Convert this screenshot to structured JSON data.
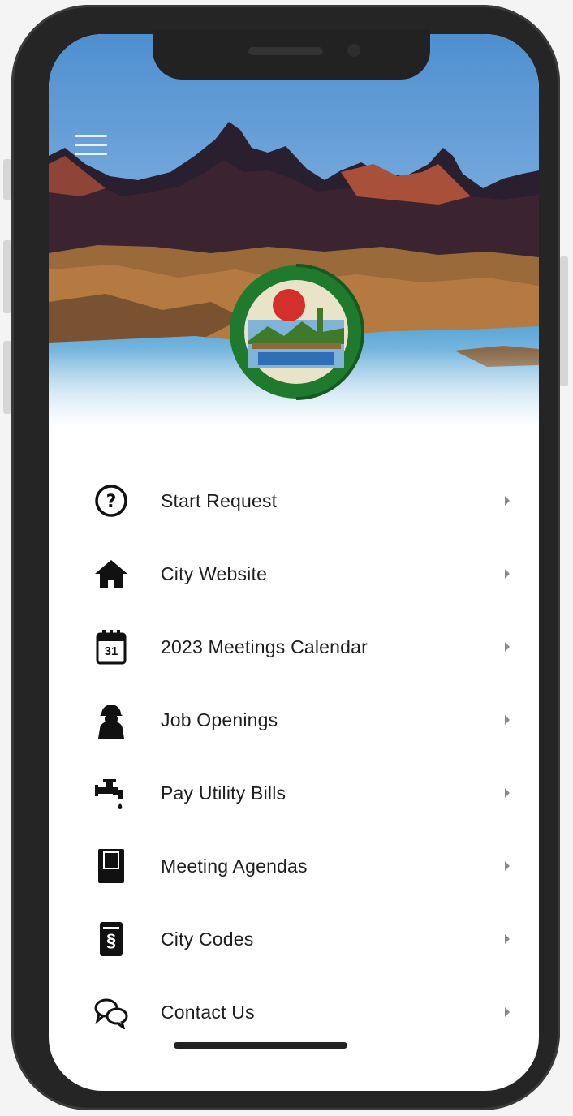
{
  "colors": {
    "frame": "#252525",
    "screen": "#ffffff",
    "text": "#1e1e1e",
    "chevron": "#8a8a8a",
    "logo_green": "#1f7a2e",
    "sun_red": "#d4302b"
  },
  "header": {
    "menu_icon": "hamburger-icon",
    "logo_icon": "city-seal-logo"
  },
  "menu": {
    "items": [
      {
        "label": "Start Request",
        "icon": "question-circle-icon"
      },
      {
        "label": "City Website",
        "icon": "home-icon"
      },
      {
        "label": "2023 Meetings Calendar",
        "icon": "calendar-icon",
        "icon_text": "31"
      },
      {
        "label": "Job Openings",
        "icon": "worker-icon"
      },
      {
        "label": "Pay Utility Bills",
        "icon": "faucet-icon"
      },
      {
        "label": "Meeting Agendas",
        "icon": "book-icon"
      },
      {
        "label": "City Codes",
        "icon": "section-document-icon",
        "icon_text": "§"
      },
      {
        "label": "Contact Us",
        "icon": "chat-bubbles-icon"
      }
    ]
  }
}
